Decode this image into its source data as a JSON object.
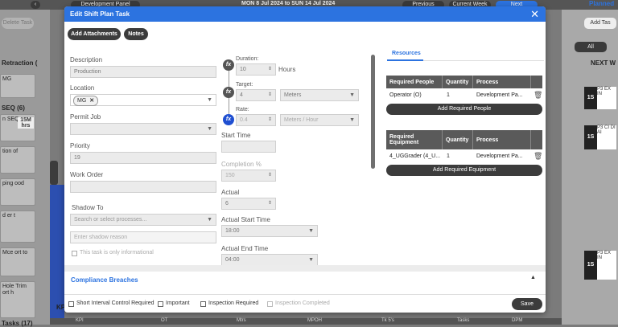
{
  "background": {
    "panel_select": "Development Panel",
    "date_range": "MON 8 Jul 2024 to SUN 14 Jul 2024",
    "previous": "Previous",
    "current_week": "Current Week",
    "next": "Next",
    "planned": "Planned",
    "add_task": "Add Tas",
    "delete_task": "Delete Task",
    "all": "All",
    "next_w": "NEXT W",
    "retraction": "Retraction (",
    "seq": "SEQ (6)",
    "tasks": "Tasks (17)",
    "kpi": "KPI",
    "bottom_cols": [
      "KPI",
      "OT",
      "Mtrs",
      "MPOH",
      "Tk 5's",
      "Tasks",
      "DPM"
    ],
    "left_cards": [
      "MG",
      "n SEQ",
      "tion of",
      "ping ood",
      "d er t",
      "Mce ort to",
      "Hole Trim ort h"
    ],
    "card_badge": "15M hrs",
    "right_cards": [
      "1S",
      "1S",
      "1S"
    ],
    "right_texts": [
      "P3 EX IN",
      "P3 CI DI AI",
      "P3 EX IN"
    ]
  },
  "modal": {
    "title": "Edit Shift Plan Task",
    "add_attachments": "Add Attachments",
    "notes": "Notes",
    "description_label": "Description",
    "description_value": "Production",
    "location_label": "Location",
    "location_tag": "MG",
    "permit_label": "Permit Job",
    "priority_label": "Priority",
    "priority_value": "19",
    "work_order_label": "Work Order",
    "shadow_label": "Shadow To",
    "shadow_placeholder": "Search or select processes...",
    "shadow_reason_placeholder": "Enter shadow reason",
    "informational_label": "This task is only informational",
    "duration_label": "Duration:",
    "duration_value": "10",
    "duration_unit": "Hours",
    "target_label": "Target:",
    "target_value": "4",
    "target_unit": "Meters",
    "rate_label": "Rate:",
    "rate_value": "0.4",
    "rate_unit": "Meters / Hour",
    "start_time_label": "Start Time",
    "completion_label": "Completion %",
    "completion_value": "150",
    "actual_label": "Actual",
    "actual_value": "6",
    "actual_start_label": "Actual Start Time",
    "actual_start_value": "18:00",
    "actual_end_label": "Actual End Time",
    "actual_end_value": "04:00",
    "resources_tab": "Resources",
    "people_headers": [
      "Required People",
      "Quantity",
      "Process"
    ],
    "people_rows": [
      [
        "Operator (O)",
        "1",
        "Development Pa..."
      ]
    ],
    "add_people": "Add Required People",
    "equipment_headers": [
      "Required Equipment",
      "Quantity",
      "Process"
    ],
    "equipment_rows": [
      [
        "4_UGGrader (4_U...",
        "1",
        "Development Pa..."
      ]
    ],
    "add_equipment": "Add Required Equipment",
    "compliance": "Compliance Breaches",
    "footer_checks": [
      "Short Interval Control Required",
      "Important",
      "Inspection Required",
      "Inspection Completed"
    ],
    "save": "Save"
  },
  "colors": {
    "header": "#2c73e0",
    "fx_active": "#1f4fd1",
    "button_dark": "#3c3c3c",
    "tab_accent": "#2c73e0"
  }
}
